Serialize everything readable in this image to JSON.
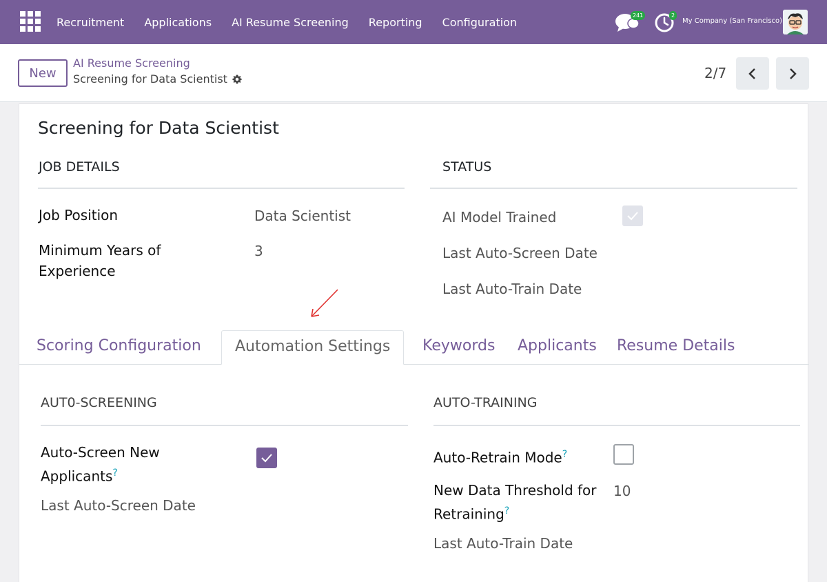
{
  "navbar": {
    "menu": [
      "Recruitment",
      "Applications",
      "AI Resume Screening",
      "Reporting",
      "Configuration"
    ],
    "chat_badge": "241",
    "activity_badge": "2",
    "company": "My Company (San Francisco)",
    "accent_color": "#765d99",
    "badge_color": "#28a745"
  },
  "control": {
    "new_label": "New",
    "breadcrumb_parent": "AI Resume Screening",
    "breadcrumb_current": "Screening for Data Scientist",
    "pager": "2/7"
  },
  "form": {
    "title": "Screening for Data Scientist",
    "job_details": {
      "heading": "JOB DETAILS",
      "job_position_label": "Job Position",
      "job_position_value": "Data Scientist",
      "min_years_label": "Minimum Years of Experience",
      "min_years_value": "3"
    },
    "status": {
      "heading": "STATUS",
      "ai_model_trained_label": "AI Model Trained",
      "ai_model_trained": true,
      "last_auto_screen_label": "Last Auto-Screen Date",
      "last_auto_train_label": "Last Auto-Train Date"
    },
    "tabs": [
      "Scoring Configuration",
      "Automation Settings",
      "Keywords",
      "Applicants",
      "Resume Details"
    ],
    "active_tab": "Automation Settings",
    "auto_screening": {
      "heading": "AUT0-SCREENING",
      "auto_screen_label": "Auto-Screen New Applicants",
      "auto_screen_value": true,
      "help": "?",
      "last_auto_screen_label": "Last Auto-Screen Date"
    },
    "auto_training": {
      "heading": "AUTO-TRAINING",
      "auto_retrain_label": "Auto-Retrain Mode",
      "auto_retrain_value": false,
      "help": "?",
      "threshold_label": "New Data Threshold for Retraining",
      "threshold_value": "10",
      "last_auto_train_label": "Last Auto-Train Date"
    }
  }
}
